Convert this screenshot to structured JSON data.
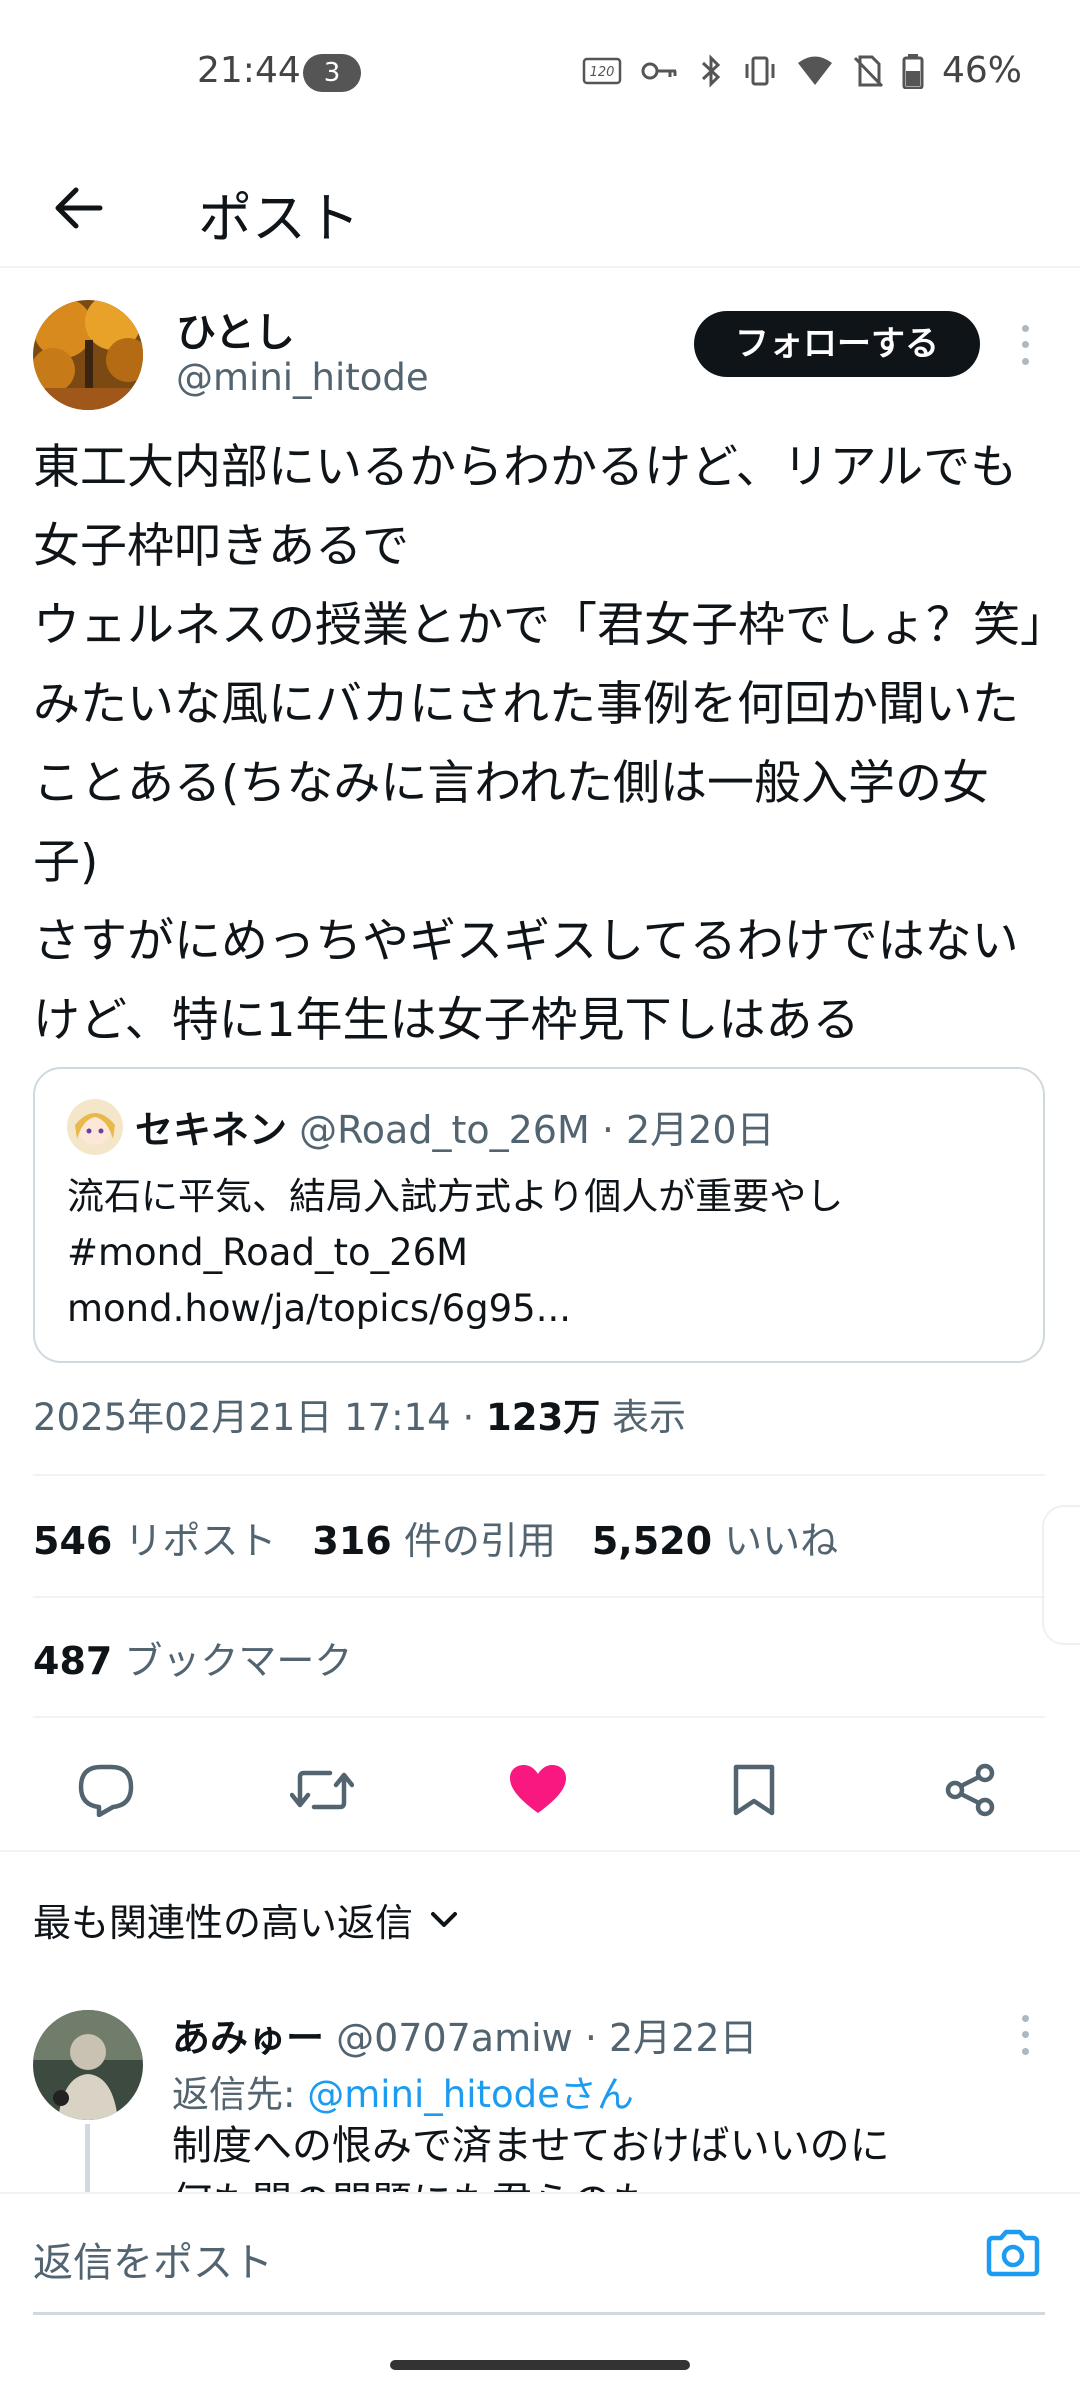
{
  "status_bar": {
    "time": "21:44",
    "notification_count": "3",
    "battery": "46%",
    "icons": [
      "refresh-120hz-icon",
      "key-icon",
      "bluetooth-icon",
      "vibrate-icon",
      "wifi-icon",
      "no-sim-icon",
      "battery-icon"
    ]
  },
  "header": {
    "title": "ポスト"
  },
  "post": {
    "author_name": "ひとし",
    "author_handle": "@mini_hitode",
    "follow_label": "フォローする",
    "text": "東工大内部にいるからわかるけど、リアルでも女子枠叩きあるで\nウェルネスの授業とかで「君女子枠でしょ？笑」みたいな風にバカにされた事例を何回か聞いたことある(ちなみに言われた側は一般入学の女子)\nさすがにめっちやギスギスしてるわけではないけど、特に1年生は女子枠見下しはある",
    "quote": {
      "name": "セキネン",
      "meta": " @Road_to_26M · 2月20日",
      "text": "流石に平気、結局入試方式より個人が重要やし\n#mond_Road_to_26M\nmond.how/ja/topics/6g95..."
    },
    "timestamp": "2025年02月21日 17:14 · ",
    "views_count": "123万",
    "views_label": " 表示",
    "stats": {
      "reposts_count": "546",
      "reposts_label": " リポスト",
      "quotes_count": "316",
      "quotes_label": " 件の引用",
      "likes_count": "5,520",
      "likes_label": " いいね",
      "bookmarks_count": "487",
      "bookmarks_label": " ブックマーク"
    },
    "liked": true,
    "like_color": "#f91880"
  },
  "replies": {
    "sort_label": "最も関連性の高い返信",
    "items": [
      {
        "name": "あみゅー",
        "meta": " @0707amiw · 2月22日",
        "reply_to_prefix": "返信先: ",
        "reply_to_handle": "@mini_hitodeさん",
        "text": "制度への恨みで済ませておけばいいのに",
        "text_cut": "何も関の問題にも君らのも"
      }
    ]
  },
  "compose": {
    "placeholder": "返信をポスト"
  },
  "colors": {
    "link": "#1d9bf0",
    "text": "#0f1419",
    "secondary": "#536471"
  }
}
